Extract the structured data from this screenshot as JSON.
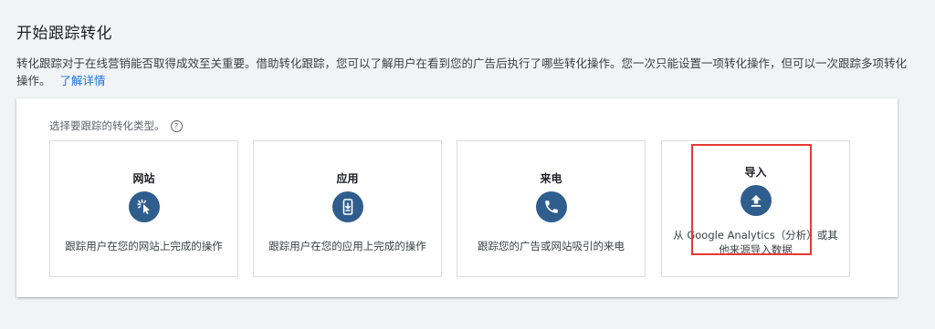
{
  "header": {
    "title": "开始跟踪转化"
  },
  "intro": {
    "text": "转化跟踪对于在线营销能否取得成效至关重要。借助转化跟踪，您可以了解用户在看到您的广告后执行了哪些转化操作。您一次只能设置一项转化操作，但可以一次跟踪多项转化操作。",
    "learn_more": "了解详情"
  },
  "selector": {
    "prompt": "选择要跟踪的转化类型。",
    "help_icon": "?",
    "options": [
      {
        "title": "网站",
        "icon": "cursor-click-icon",
        "description": "跟踪用户在您的网站上完成的操作"
      },
      {
        "title": "应用",
        "icon": "mobile-download-icon",
        "description": "跟踪用户在您的应用上完成的操作"
      },
      {
        "title": "来电",
        "icon": "phone-icon",
        "description": "跟踪您的广告或网站吸引的来电"
      },
      {
        "title": "导入",
        "icon": "upload-icon",
        "description": "从 Google Analytics（分析）或其他来源导入数据"
      }
    ]
  },
  "colors": {
    "icon_bg": "#2f5e8e",
    "link": "#1a73e8",
    "highlight": "#e53935"
  }
}
